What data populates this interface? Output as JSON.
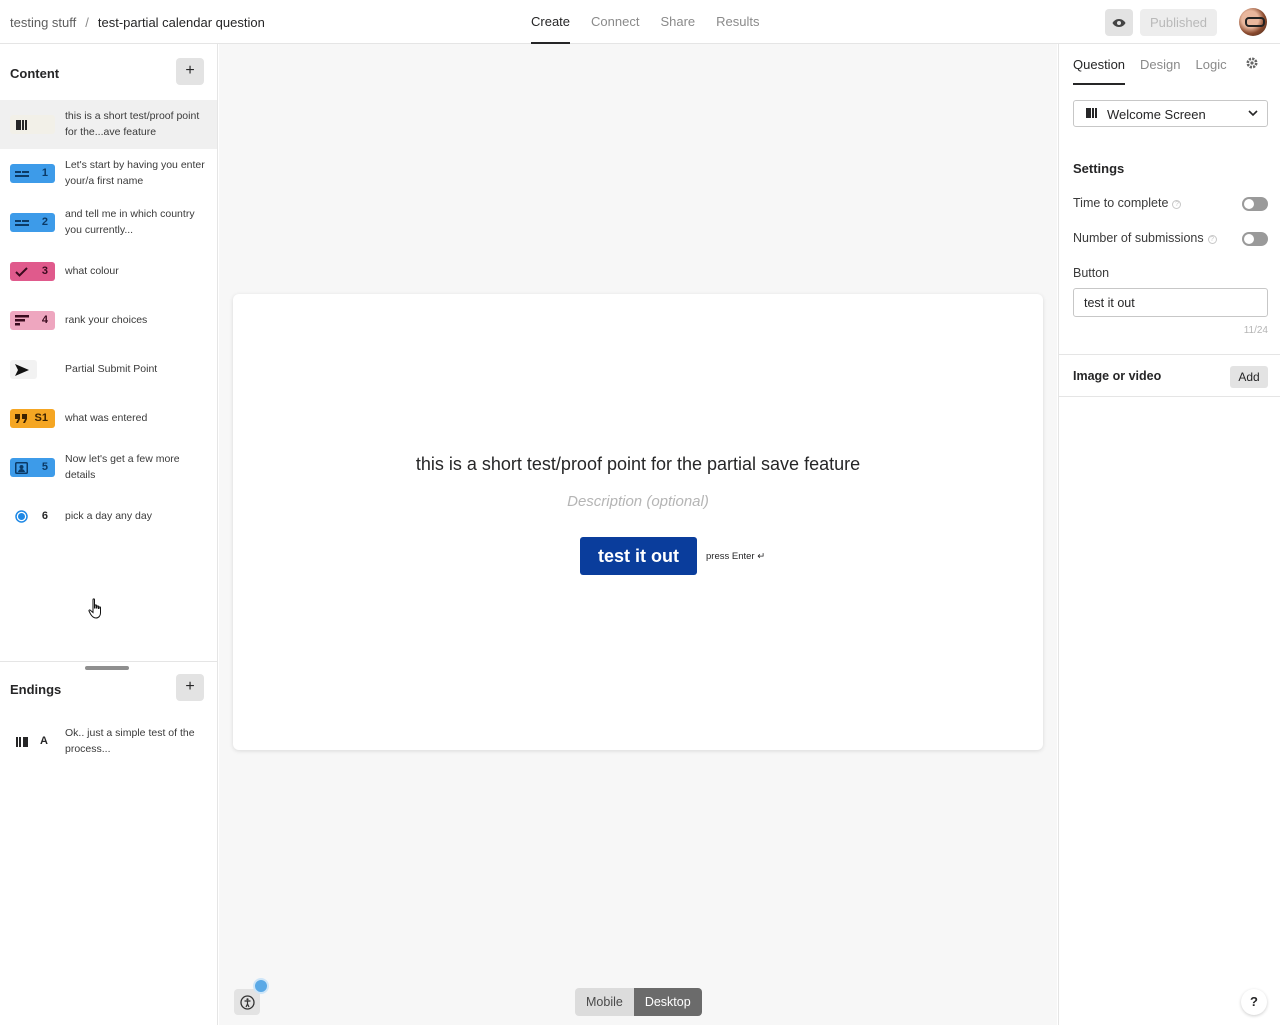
{
  "breadcrumb": {
    "workspace": "testing stuff",
    "separator": "/",
    "form": "test-partial calendar question"
  },
  "nav": {
    "tabs": [
      "Create",
      "Connect",
      "Share",
      "Results"
    ],
    "active": "Create"
  },
  "header": {
    "publish_label": "Published"
  },
  "content": {
    "title": "Content",
    "add_label": "+",
    "items": [
      {
        "icon": "welcome-screen-icon",
        "num": "",
        "color": "#f2f0e8",
        "text": "this is a short test/proof point for the...ave feature",
        "selected": true
      },
      {
        "icon": "short-text-icon",
        "num": "1",
        "color": "#3d9be9",
        "text": "Let's start by having you enter your/a first name"
      },
      {
        "icon": "short-text-icon",
        "num": "2",
        "color": "#3d9be9",
        "text": "and tell me in which country you currently..."
      },
      {
        "icon": "checkmark-icon",
        "num": "3",
        "color": "#e05a8c",
        "text": "what colour"
      },
      {
        "icon": "ranking-icon",
        "num": "4",
        "color": "#eea6bf",
        "text": "rank your choices"
      },
      {
        "icon": "send-icon",
        "num": "",
        "color": "#f2f2f2",
        "text": "Partial Submit Point"
      },
      {
        "icon": "quote-icon",
        "num": "S1",
        "color": "#f5a623",
        "text": "what was entered"
      },
      {
        "icon": "contact-card-icon",
        "num": "5",
        "color": "#3d9be9",
        "text": "Now let's get a few more details"
      },
      {
        "icon": "radio-icon",
        "num": "6",
        "color": "#ffffff",
        "text": "pick a day any day"
      }
    ]
  },
  "endings": {
    "title": "Endings",
    "add_label": "+",
    "items": [
      {
        "icon": "ending-screen-icon",
        "num": "A",
        "text": "Ok.. just a simple test of the process..."
      }
    ]
  },
  "card": {
    "title": "this is a short test/proof point for the partial save feature",
    "description": "Description (optional)",
    "button": "test it out",
    "hint": "press Enter ↵"
  },
  "view_toggle": {
    "options": [
      "Mobile",
      "Desktop"
    ],
    "active": "Desktop"
  },
  "panel": {
    "tabs": [
      "Question",
      "Design",
      "Logic"
    ],
    "active_tab": "Question",
    "block_type": "Welcome Screen",
    "settings_title": "Settings",
    "time_to_complete": "Time to complete",
    "time_to_complete_on": false,
    "number_of_submissions": "Number of submissions",
    "number_of_submissions_on": false,
    "button_label": "Button",
    "button_value": "test it out",
    "counter": "11/24",
    "image_or_video": "Image or video",
    "add_label": "Add",
    "help": "?"
  }
}
